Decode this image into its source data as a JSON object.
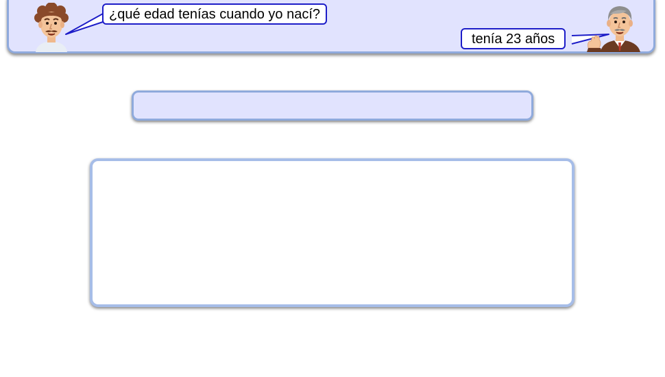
{
  "dialogue": {
    "question": "¿qué edad tenías cuando yo nací?",
    "answer": "tenía 23 años"
  },
  "answer_bar": {
    "value": ""
  },
  "work_area": {
    "content": ""
  },
  "colors": {
    "panel_fill": "#e1e3fe",
    "panel_border": "#8faadc",
    "bubble_border": "#1c1cc8",
    "work_area_border": "#a6bde8"
  },
  "icons": {
    "young_character": "young-man-avatar-icon",
    "old_character": "grandfather-avatar-icon"
  }
}
